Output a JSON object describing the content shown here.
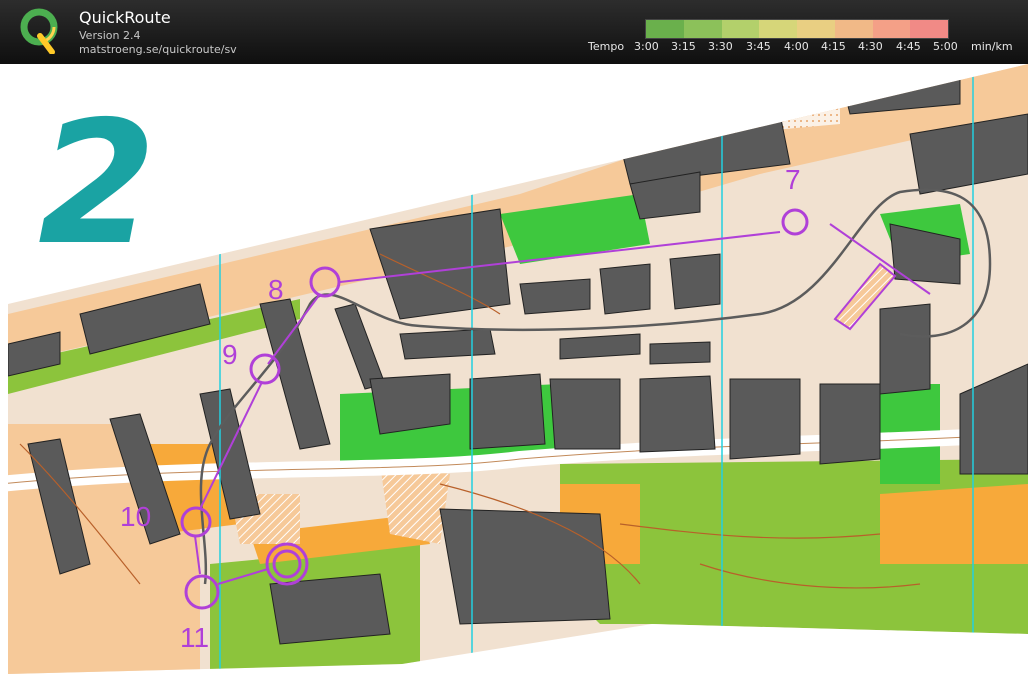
{
  "app": {
    "name": "QuickRoute",
    "version": "Version 2.4",
    "url": "matstroeng.se/quickroute/sv"
  },
  "tempo_legend": {
    "label": "Tempo",
    "ticks": [
      "3:00",
      "3:15",
      "3:30",
      "3:45",
      "4:00",
      "4:15",
      "4:30",
      "4:45",
      "5:00"
    ],
    "unit": "min/km",
    "colors": [
      "#6ab04c",
      "#8cc15a",
      "#b3d06b",
      "#d6d679",
      "#e9cf82",
      "#f1b987",
      "#f4a087",
      "#f18a86"
    ]
  },
  "map": {
    "leg_number": "2",
    "controls": [
      "7",
      "8",
      "9",
      "10",
      "11"
    ],
    "colors": {
      "course": "#b040d8",
      "route": "#5c5c5c",
      "building": "#5a5a5a",
      "open": "#f6c999",
      "rough": "#f7a93a",
      "green": "#8cc43c",
      "bright_green": "#3ec83e",
      "paved": "#f1e1d0",
      "leg_number": "#1aa3a3",
      "magnetic_north": "#23d0df"
    }
  }
}
